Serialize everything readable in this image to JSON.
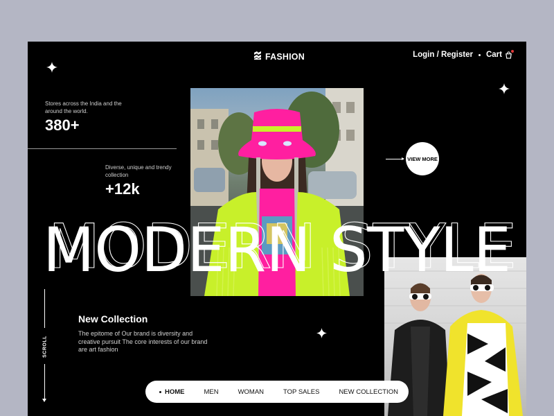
{
  "brand": {
    "name": "FASHION",
    "logo_icon": "zigzag-logo-icon"
  },
  "header": {
    "login_label": "Login / Register",
    "cart_label": "Cart",
    "cart_icon": "shopping-bag-icon",
    "badge_color": "#e23a3a"
  },
  "stats": [
    {
      "caption": "Stores across the India and the around the world.",
      "value": "380+"
    },
    {
      "caption": "Diverse, unique and trendy collection",
      "value": "+12k"
    }
  ],
  "hero": {
    "headline": "MODERN STYLE",
    "view_more_label": "VIEW MORE"
  },
  "scroll_label": "SCROLL",
  "new_collection": {
    "title": "New Collection",
    "description": "The epitome of Our brand is diversity and creative pursuit The core interests of our brand are art fashion"
  },
  "bottom_nav": {
    "items": [
      {
        "label": "HOME",
        "active": true
      },
      {
        "label": "MEN",
        "active": false
      },
      {
        "label": "WOMAN",
        "active": false
      },
      {
        "label": "TOP SALES",
        "active": false
      },
      {
        "label": "NEW COLLECTION",
        "active": false
      }
    ]
  },
  "colors": {
    "page_background": "#b4b6c4",
    "frame_background": "#000000",
    "accent_neon": "#c8f02a",
    "accent_pink": "#ff1fa0"
  }
}
